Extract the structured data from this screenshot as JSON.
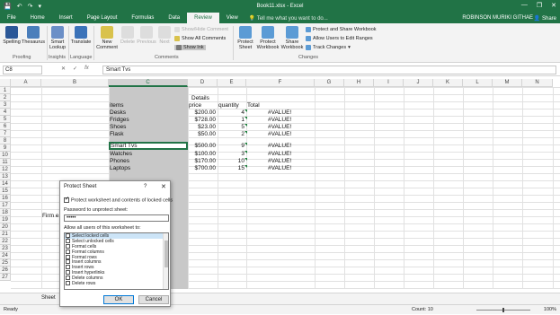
{
  "window": {
    "title": "Book11.xlsx - Excel",
    "minimize": "—",
    "restore": "❐",
    "close": "✕"
  },
  "qat": {
    "save": "💾",
    "undo": "↶",
    "redo": "↷",
    "more": "▾"
  },
  "tabs": [
    "File",
    "Home",
    "Insert",
    "Page Layout",
    "Formulas",
    "Data",
    "Review",
    "View"
  ],
  "active_tab": "Review",
  "tell_me": "Tell me what you want to do...",
  "user": "ROBINSON MURIKI GITHAE",
  "share": "Share",
  "ribbon": {
    "spelling": "Spelling",
    "thesaurus": "Thesaurus",
    "smart_lookup": "Smart Lookup",
    "translate": "Translate",
    "new_comment": "New Comment",
    "delete": "Delete",
    "previous": "Previous",
    "next": "Next",
    "show_hide_comment": "Show/Hide Comment",
    "show_all_comments": "Show All Comments",
    "show_ink": "Show Ink",
    "protect_sheet": "Protect Sheet",
    "protect_workbook": "Protect Workbook",
    "share_workbook": "Share Workbook",
    "protect_share_workbook": "Protect and Share Workbook",
    "allow_users_edit": "Allow Users to Edit Ranges",
    "track_changes": "Track Changes",
    "groups": {
      "proofing": "Proofing",
      "insights": "Insights",
      "language": "Language",
      "comments": "Comments",
      "changes": "Changes"
    }
  },
  "formula_bar": {
    "name_box": "C8",
    "cancel": "✕",
    "enter": "✓",
    "fx": "fx",
    "value": "Smart Tvs"
  },
  "columns": [
    "A",
    "B",
    "C",
    "D",
    "E",
    "F",
    "G",
    "H",
    "I",
    "J",
    "K",
    "L",
    "M",
    "N"
  ],
  "rows": [
    "1",
    "2",
    "3",
    "4",
    "5",
    "6",
    "7",
    "8",
    "9",
    "10",
    "11",
    "12",
    "13",
    "14",
    "15",
    "16",
    "17",
    "18",
    "19",
    "20",
    "21",
    "22",
    "23",
    "24",
    "25",
    "26",
    "27"
  ],
  "cells": {
    "D2": "Details",
    "C3": "items",
    "D3": "price",
    "E3": "quantity",
    "F3": "Total",
    "C4": "Desks",
    "D4": "$200.00",
    "E4": "4",
    "F4": "#VALUE!",
    "C5": "Fridges",
    "D5": "$728.00",
    "E5": "1",
    "F5": "#VALUE!",
    "C6": "Shoes",
    "D6": "$23.00",
    "E6": "5",
    "F6": "#VALUE!",
    "C7": "Flask",
    "D7": "$50.00",
    "E7": "2",
    "F7": "#VALUE!",
    "C8": "Smart Tvs",
    "D8": "$500.00",
    "E8": "9",
    "F8": "#VALUE!",
    "C9": "Watches",
    "D9": "$100.00",
    "E9": "3",
    "F9": "#VALUE!",
    "C10": "Phones",
    "D10": "$170.00",
    "E10": "10",
    "F10": "#VALUE!",
    "C11": "Laptops",
    "D11": "$700.00",
    "E11": "15",
    "F11": "#VALUE!",
    "B17": "Firm e"
  },
  "sheet_tab": "Sheet",
  "status": {
    "ready": "Ready",
    "count": "Count: 10",
    "zoom": "100%"
  },
  "dialog": {
    "title": "Protect Sheet",
    "help": "?",
    "close": "✕",
    "protect_label": "Protect worksheet and contents of locked cells",
    "password_label": "Password to unprotect sheet:",
    "password_value": "•••••",
    "allow_label": "Allow all users of this worksheet to:",
    "permissions": [
      {
        "label": "Select locked cells",
        "checked": true
      },
      {
        "label": "Select unlocked cells",
        "checked": true
      },
      {
        "label": "Format cells",
        "checked": false
      },
      {
        "label": "Format columns",
        "checked": false
      },
      {
        "label": "Format rows",
        "checked": false
      },
      {
        "label": "Insert columns",
        "checked": false
      },
      {
        "label": "Insert rows",
        "checked": false
      },
      {
        "label": "Insert hyperlinks",
        "checked": false
      },
      {
        "label": "Delete columns",
        "checked": false
      },
      {
        "label": "Delete rows",
        "checked": false
      }
    ],
    "ok": "OK",
    "cancel": "Cancel"
  },
  "colors": {
    "accent": "#217346",
    "selected_column": "#c8c8c8"
  }
}
